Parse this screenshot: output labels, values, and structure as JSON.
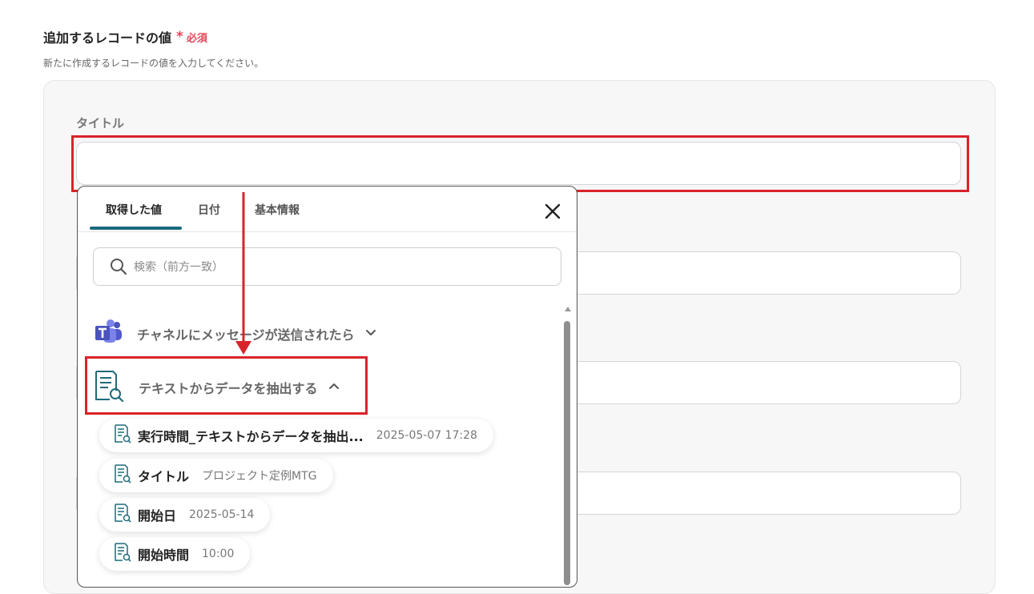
{
  "section": {
    "title": "追加するレコードの値",
    "required_star": "*",
    "required_text": "必須",
    "description": "新たに作成するレコードの値を入力してください。"
  },
  "field": {
    "label": "タイトル",
    "value": ""
  },
  "popup": {
    "tabs": [
      {
        "label": "取得した値",
        "active": true
      },
      {
        "label": "日付",
        "active": false
      },
      {
        "label": "基本情報",
        "active": false
      }
    ],
    "search": {
      "placeholder": "検索（前方一致）",
      "value": ""
    },
    "groups": [
      {
        "label": "チャネルにメッセージが送信されたら",
        "icon": "teams-icon",
        "expanded": false
      },
      {
        "label": "テキストからデータを抽出する",
        "icon": "document-search-icon",
        "expanded": true
      }
    ],
    "items": [
      {
        "name": "実行時間_テキストからデータを抽出...",
        "value": "2025-05-07 17:28"
      },
      {
        "name": "タイトル",
        "value": "プロジェクト定例MTG"
      },
      {
        "name": "開始日",
        "value": "2025-05-14"
      },
      {
        "name": "開始時間",
        "value": "10:00"
      }
    ]
  },
  "colors": {
    "highlight": "#d9232a",
    "accent": "#1a6a7e",
    "required": "#e04858",
    "icon_teal": "#1f6a7a"
  }
}
